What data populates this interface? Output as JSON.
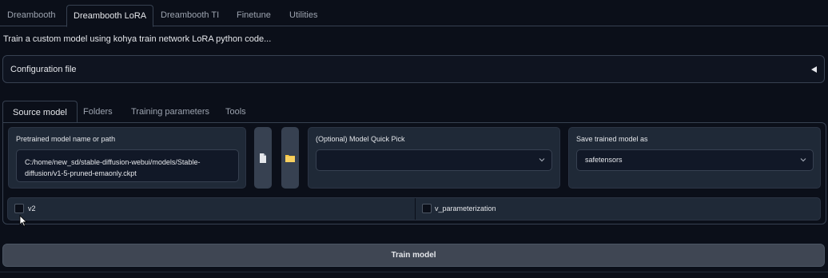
{
  "top_tabs": [
    {
      "label": "Dreambooth",
      "active": false
    },
    {
      "label": "Dreambooth LoRA",
      "active": true
    },
    {
      "label": "Dreambooth TI",
      "active": false
    },
    {
      "label": "Finetune",
      "active": false
    },
    {
      "label": "Utilities",
      "active": false
    }
  ],
  "description": "Train a custom model using kohya train network LoRA python code...",
  "config": {
    "label": "Configuration file",
    "arrow_icon": "triangle-left-icon"
  },
  "sub_tabs": [
    {
      "label": "Source model",
      "active": true
    },
    {
      "label": "Folders",
      "active": false
    },
    {
      "label": "Training parameters",
      "active": false
    },
    {
      "label": "Tools",
      "active": false
    }
  ],
  "pretrained": {
    "label": "Pretrained model name or path",
    "value": "C:/home/new_sd/stable-diffusion-webui/models/Stable-\ndiffusion/v1-5-pruned-emaonly.ckpt"
  },
  "buttons": {
    "file_icon": "document-icon",
    "folder_icon": "folder-icon"
  },
  "quick_pick": {
    "label": "(Optional) Model Quick Pick",
    "value": ""
  },
  "save_as": {
    "label": "Save trained model as",
    "value": "safetensors"
  },
  "checkboxes": {
    "v2": {
      "label": "v2",
      "checked": false
    },
    "v_param": {
      "label": "v_parameterization",
      "checked": false
    }
  },
  "train_button": "Train model",
  "colors": {
    "background": "#0b0f19",
    "block": "#1f2937",
    "border": "#374151",
    "folder_yellow": "#f5c542"
  }
}
